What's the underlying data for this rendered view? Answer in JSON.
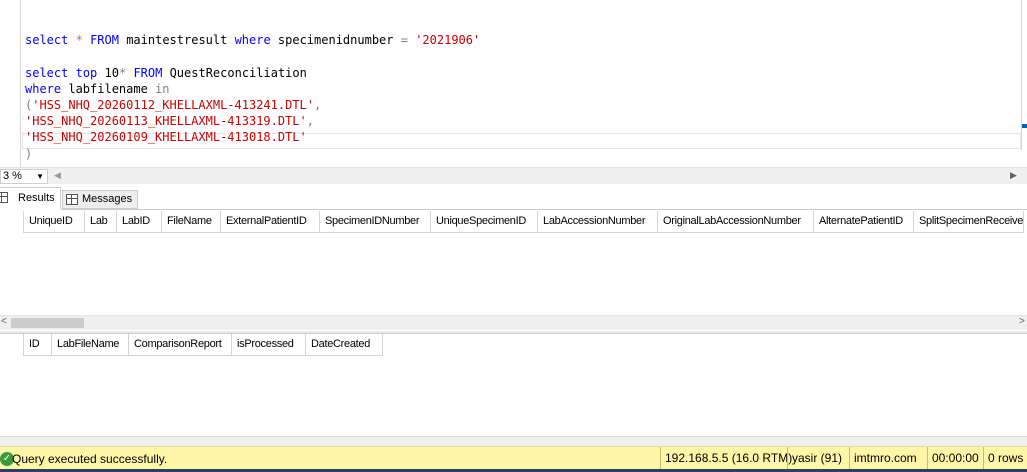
{
  "editor": {
    "lines": [
      [],
      [
        {
          "t": "select",
          "c": "kw"
        },
        {
          "t": " ",
          "c": "tx"
        },
        {
          "t": "*",
          "c": "gr"
        },
        {
          "t": " ",
          "c": "tx"
        },
        {
          "t": "FROM",
          "c": "kw"
        },
        {
          "t": " maintestresult ",
          "c": "tx"
        },
        {
          "t": "where",
          "c": "kw"
        },
        {
          "t": " specimenidnumber ",
          "c": "tx"
        },
        {
          "t": "=",
          "c": "gr"
        },
        {
          "t": " ",
          "c": "tx"
        },
        {
          "t": "'2021906'",
          "c": "st"
        }
      ],
      [],
      [
        {
          "t": "select",
          "c": "kw"
        },
        {
          "t": " ",
          "c": "tx"
        },
        {
          "t": "top",
          "c": "kw"
        },
        {
          "t": " 10",
          "c": "tx"
        },
        {
          "t": "*",
          "c": "gr"
        },
        {
          "t": " ",
          "c": "tx"
        },
        {
          "t": "FROM",
          "c": "kw"
        },
        {
          "t": " QuestReconciliation",
          "c": "tx"
        }
      ],
      [
        {
          "t": "where",
          "c": "kw"
        },
        {
          "t": " labfilename ",
          "c": "tx"
        },
        {
          "t": "in",
          "c": "gr"
        }
      ],
      [
        {
          "t": "(",
          "c": "gr"
        },
        {
          "t": "'HSS_NHQ_20260112_KHELLAXML-413241.DTL'",
          "c": "st"
        },
        {
          "t": ",",
          "c": "gr"
        }
      ],
      [
        {
          "t": "'HSS_NHQ_20260113_KHELLAXML-413319.DTL'",
          "c": "st"
        },
        {
          "t": ",",
          "c": "gr"
        }
      ],
      [
        {
          "t": "'HSS_NHQ_20260109_KHELLAXML-413018.DTL'",
          "c": "st"
        }
      ],
      [
        {
          "t": ")",
          "c": "gr"
        }
      ]
    ]
  },
  "zoom": {
    "value": "3 %"
  },
  "tabs": {
    "results": "Results",
    "messages": "Messages"
  },
  "grid1": {
    "columns": [
      "UniqueID",
      "Lab",
      "LabID",
      "FileName",
      "ExternalPatientID",
      "SpecimenIDNumber",
      "UniqueSpecimenID",
      "LabAccessionNumber",
      "OriginalLabAccessionNumber",
      "AlternatePatientID",
      "SplitSpecimenReceive"
    ]
  },
  "grid2": {
    "columns": [
      "ID",
      "LabFileName",
      "ComparisonReport",
      "isProcessed",
      "DateCreated"
    ]
  },
  "status": {
    "message": "Query executed successfully.",
    "server": "192.168.5.5 (16.0 RTM)",
    "user": "yasir (91)",
    "database": "imtmro.com",
    "elapsed": "00:00:00",
    "rows": "0 rows"
  },
  "colors": {
    "keyword": "#0000ff",
    "string": "#cc0000",
    "operator": "#808080",
    "statusbar": "#fff6a8",
    "success": "#3c9a3c"
  }
}
